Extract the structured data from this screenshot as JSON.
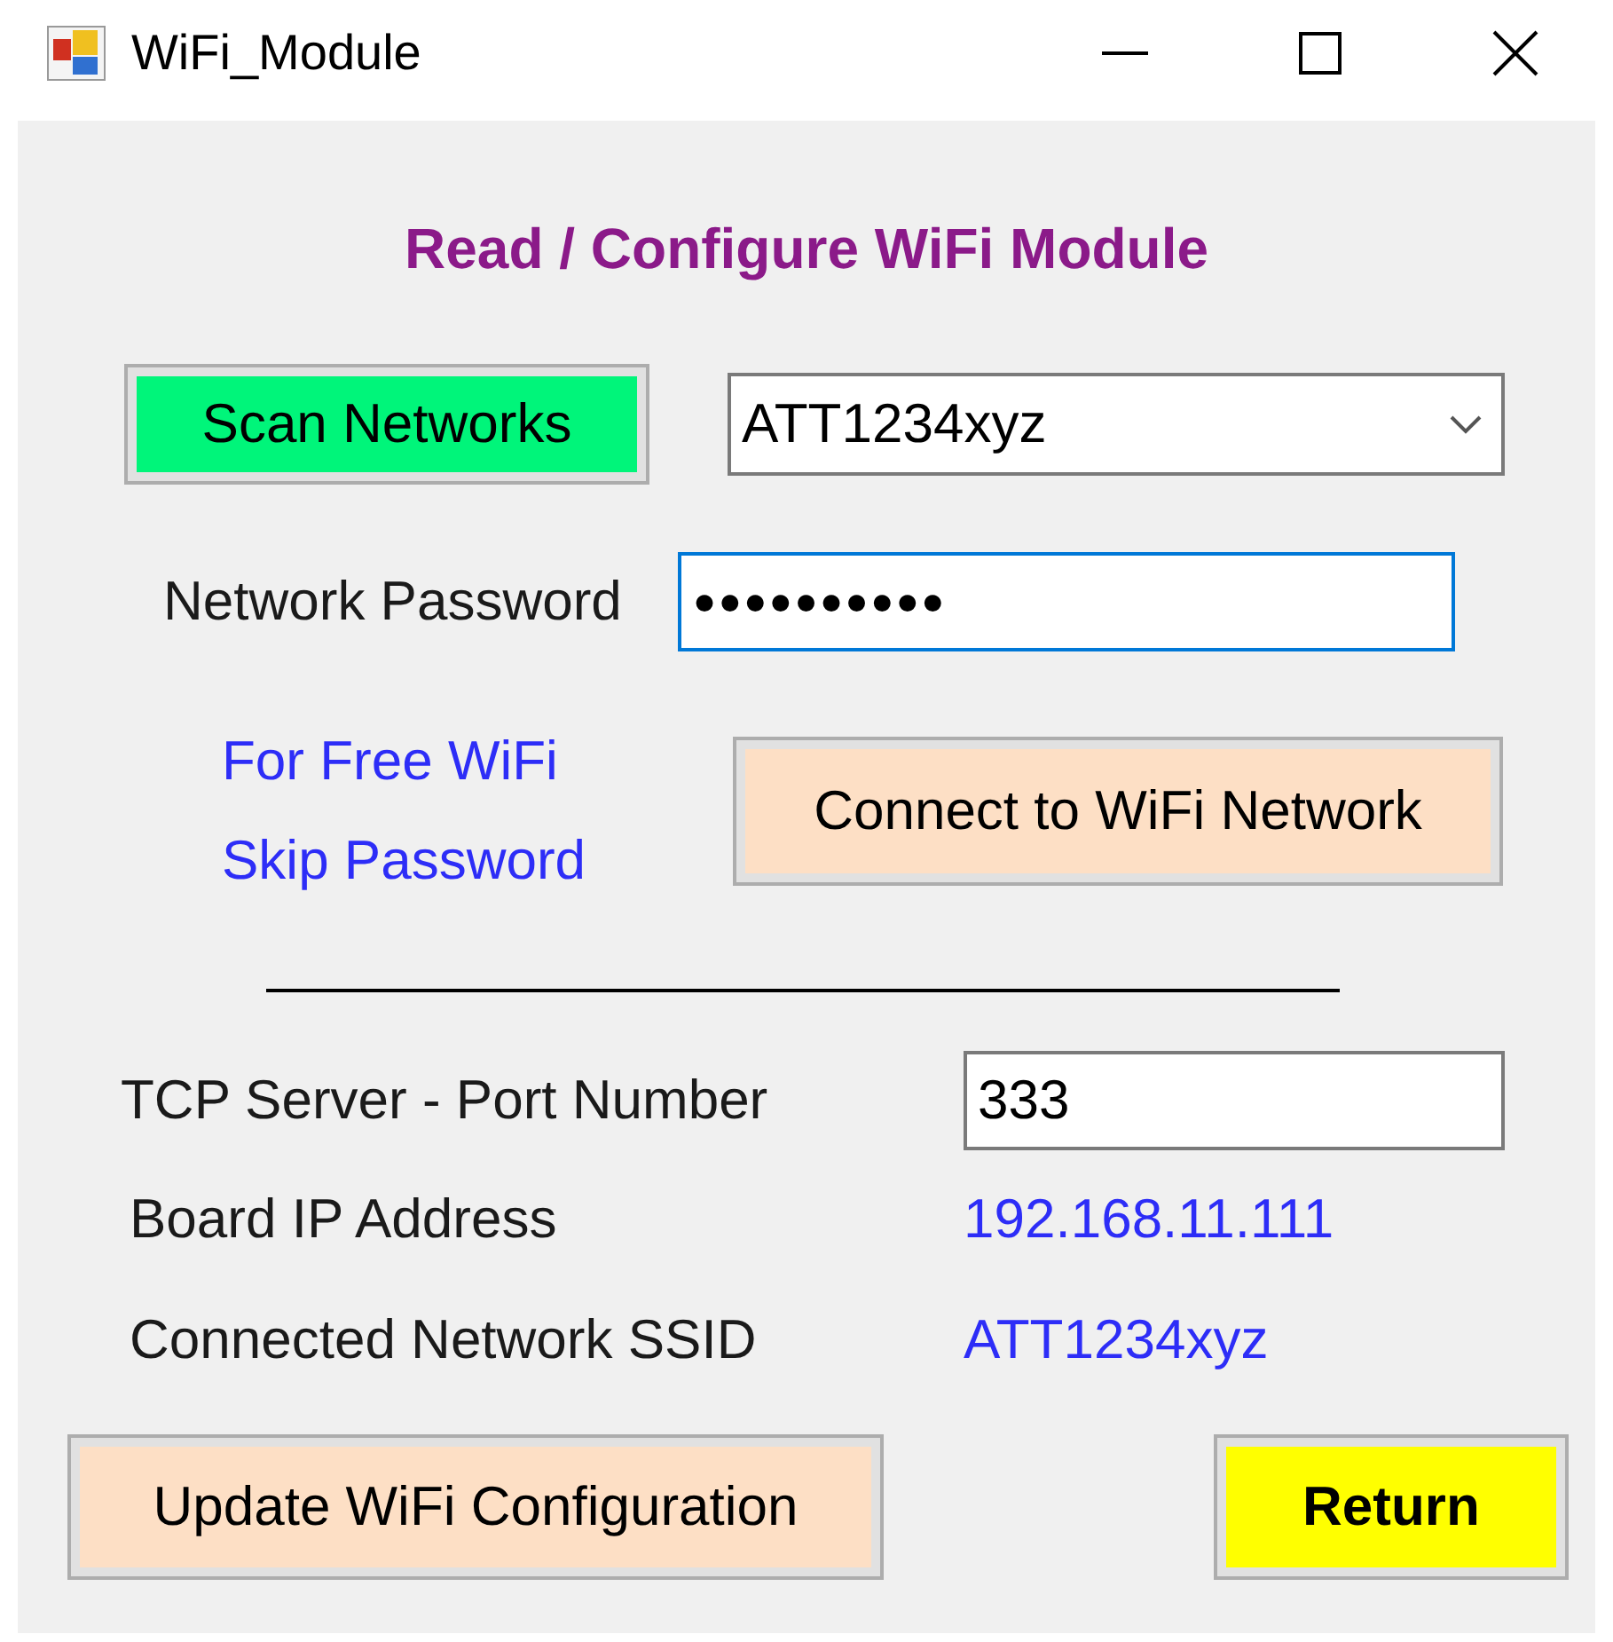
{
  "window": {
    "title": "WiFi_Module"
  },
  "heading": "Read / Configure WiFi Module",
  "scan_button": {
    "label": "Scan Networks"
  },
  "network_select": {
    "value": "ATT1234xyz"
  },
  "password": {
    "label": "Network Password",
    "value": "●●●●●●●●●●",
    "focused": true
  },
  "free_wifi_hint": [
    "For Free WiFi",
    "Skip Password"
  ],
  "connect_button": {
    "label": "Connect to WiFi Network"
  },
  "port": {
    "label": "TCP Server - Port Number",
    "value": "333"
  },
  "info": [
    {
      "label": "Board IP Address",
      "value": "192.168.11.111"
    },
    {
      "label": "Connected Network SSID",
      "value": "ATT1234xyz"
    }
  ],
  "update_button": {
    "label": "Update WiFi Configuration"
  },
  "return_button": {
    "label": "Return"
  }
}
